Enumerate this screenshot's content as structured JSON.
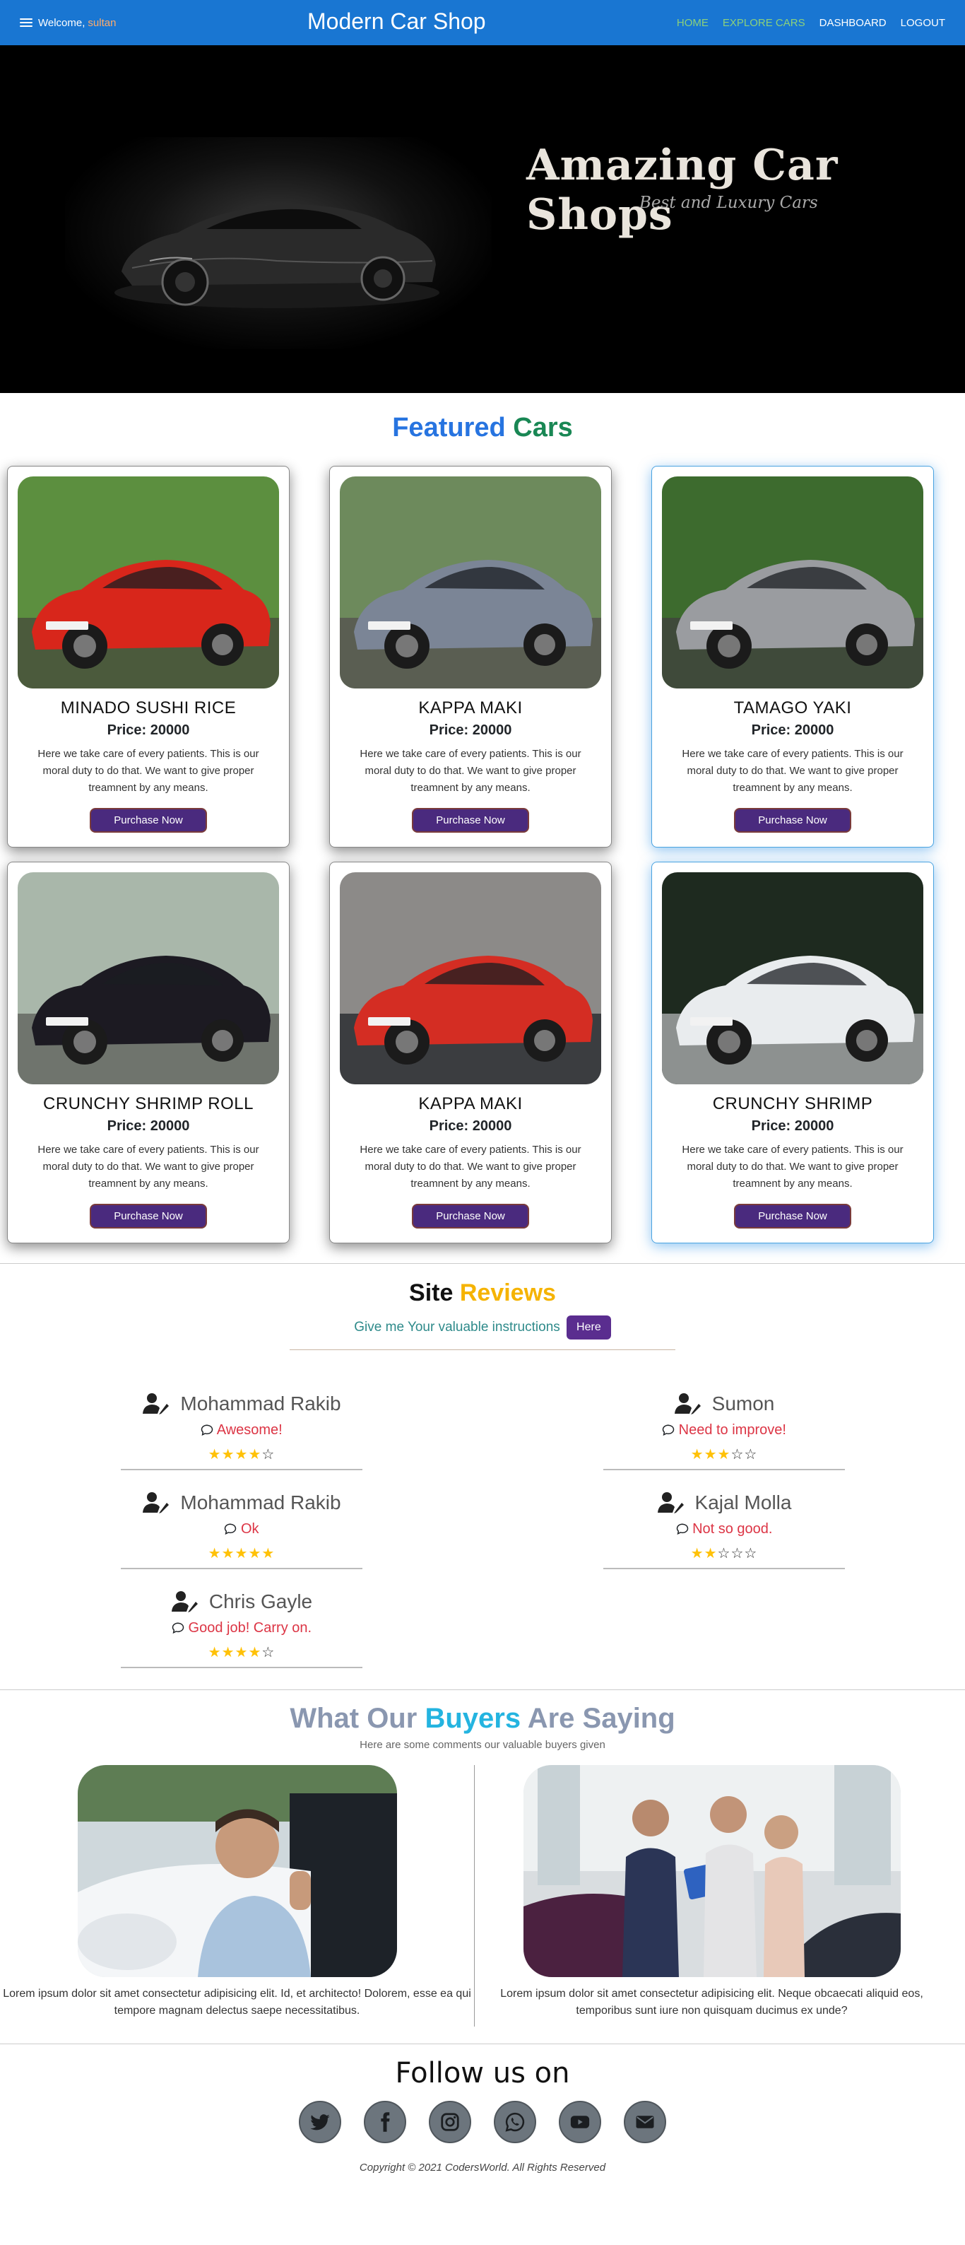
{
  "nav": {
    "welcome": "Welcome,",
    "user": "sultan",
    "brand": "Modern Car Shop",
    "links": [
      "HOME",
      "EXPLORE CARS",
      "DASHBOARD",
      "LOGOUT"
    ]
  },
  "hero": {
    "title": "Amazing Car Shops",
    "subtitle": "Best and Luxury Cars"
  },
  "featured": {
    "title_a": "Featured",
    "title_b": "Cars",
    "cards": [
      {
        "name": "MINADO SUSHI RICE",
        "price": "Price: 20000",
        "desc": "Here we take care of every patients. This is our moral duty to do that. We want to give proper treamnent by any means.",
        "button": "Purchase Now",
        "car_color": "#d8261b"
      },
      {
        "name": "KAPPA MAKI",
        "price": "Price: 20000",
        "desc": "Here we take care of every patients. This is our moral duty to do that. We want to give proper treamnent by any means.",
        "button": "Purchase Now",
        "car_color": "#7b8596"
      },
      {
        "name": "TAMAGO YAKI",
        "price": "Price: 20000",
        "desc": "Here we take care of every patients. This is our moral duty to do that. We want to give proper treamnent by any means.",
        "button": "Purchase Now",
        "car_color": "#9a9ca0"
      },
      {
        "name": "CRUNCHY SHRIMP ROLL",
        "price": "Price: 20000",
        "desc": "Here we take care of every patients. This is our moral duty to do that. We want to give proper treamnent by any means.",
        "button": "Purchase Now",
        "car_color": "#1c1a22"
      },
      {
        "name": "KAPPA MAKI",
        "price": "Price: 20000",
        "desc": "Here we take care of every patients. This is our moral duty to do that. We want to give proper treamnent by any means.",
        "button": "Purchase Now",
        "car_color": "#d42d23"
      },
      {
        "name": "CRUNCHY SHRIMP",
        "price": "Price: 20000",
        "desc": "Here we take care of every patients. This is our moral duty to do that. We want to give proper treamnent by any means.",
        "button": "Purchase Now",
        "car_color": "#e9ecee"
      }
    ]
  },
  "reviews": {
    "title_a": "Site",
    "title_b": "Reviews",
    "subtitle": "Give me Your valuable instructions",
    "here_button": "Here",
    "items": [
      {
        "name": "Mohammad Rakib",
        "comment": "Awesome!",
        "stars": 4
      },
      {
        "name": "Sumon",
        "comment": "Need to improve!",
        "stars": 3
      },
      {
        "name": "Mohammad Rakib",
        "comment": "Ok",
        "stars": 5
      },
      {
        "name": "Kajal Molla",
        "comment": "Not so good.",
        "stars": 2
      },
      {
        "name": "Chris Gayle",
        "comment": "Good job! Carry on.",
        "stars": 4
      }
    ]
  },
  "buyers": {
    "title_a": "What Our",
    "title_b": "Buyers",
    "title_c": "Are Saying",
    "subtitle": "Here are some comments our valuable buyers given",
    "items": [
      {
        "text": "Lorem ipsum dolor sit amet consectetur adipisicing elit. Id, et architecto! Dolorem, esse ea qui tempore magnam delectus saepe necessitatibus."
      },
      {
        "text": "Lorem ipsum dolor sit amet consectetur adipisicing elit. Neque obcaecati aliquid eos, temporibus sunt iure non quisquam ducimus ex unde?"
      }
    ]
  },
  "follow": {
    "title": "Follow us on",
    "icons": [
      "twitter-icon",
      "facebook-icon",
      "instagram-icon",
      "whatsapp-icon",
      "youtube-icon",
      "email-icon"
    ],
    "copyright": "Copyright © 2021 CodersWorld. All Rights Reserved"
  }
}
